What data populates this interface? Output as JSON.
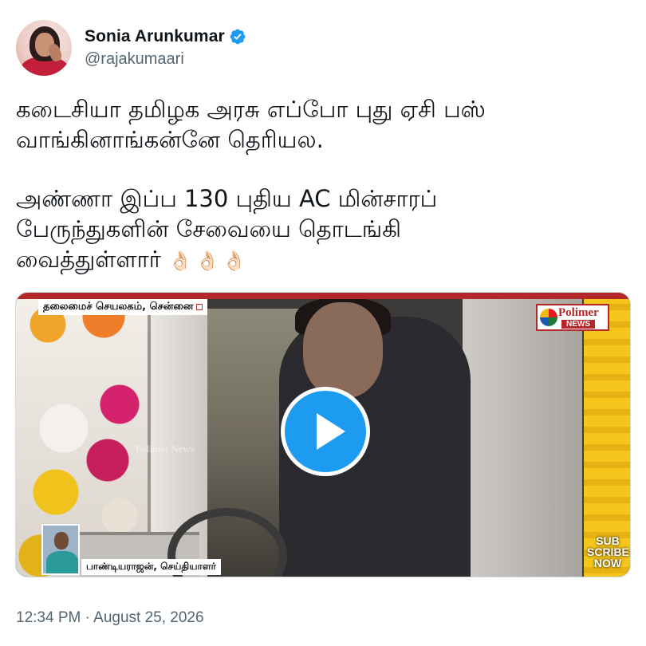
{
  "author": {
    "display_name": "Sonia Arunkumar",
    "handle": "@rajakumaari",
    "verified": true,
    "verified_color": "#1d9bf0"
  },
  "tweet": {
    "line1": "கடைசியா தமிழக அரசு எப்போ புது ஏசி பஸ்",
    "line2": "வாங்கினாங்கன்னே தெரியல.",
    "line3": "அண்ணா இப்ப 130 புதிய AC மின்சாரப்",
    "line4": "பேருந்துகளின் சேவையை தொடங்கி",
    "line5": "வைத்துள்ளார்",
    "emoji": "👌🏻👌🏻👌🏻"
  },
  "media": {
    "type": "video",
    "play_icon": "play-icon",
    "top_tag": "தலைமைச் செயலகம், சென்னை",
    "logo_brand": "Polimer",
    "logo_sub": "NEWS",
    "watermark": "Polimer News",
    "reporter_tag": "பாண்டியராஜன், செய்தியாளர்",
    "subscribe_line1": "SUB",
    "subscribe_line2": "SCRIBE",
    "subscribe_line3": "NOW"
  },
  "timestamp": "12:34 PM · August 25, 2026"
}
